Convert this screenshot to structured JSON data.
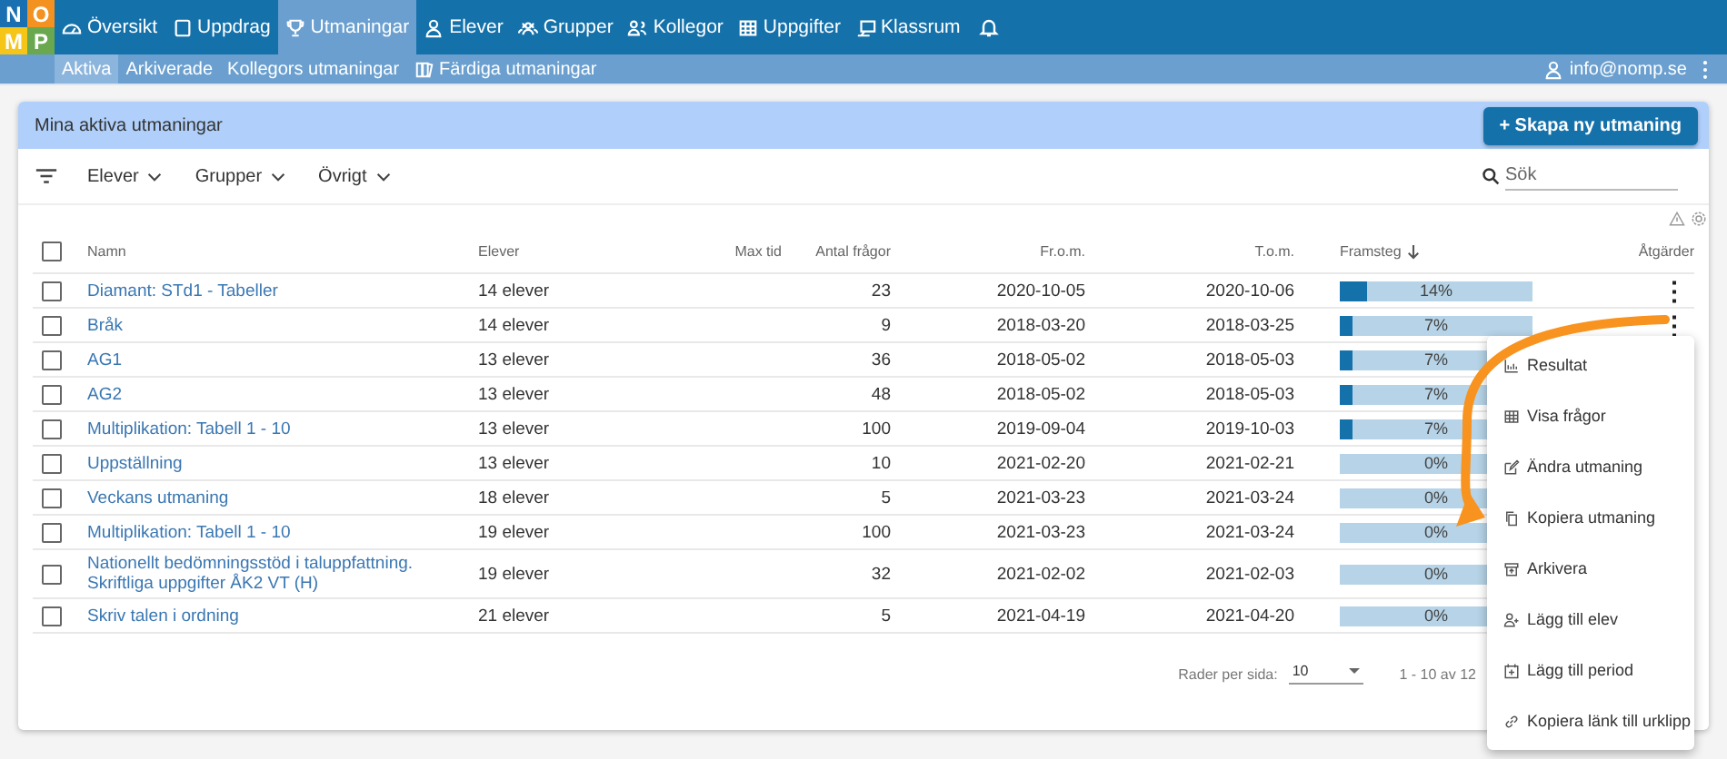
{
  "logo": {
    "letters": [
      "N",
      "O",
      "M",
      "P"
    ]
  },
  "nav": [
    {
      "label": "Översikt",
      "selected": false
    },
    {
      "label": "Uppdrag",
      "selected": false
    },
    {
      "label": "Utmaningar",
      "selected": true
    },
    {
      "label": "Elever",
      "selected": false
    },
    {
      "label": "Grupper",
      "selected": false
    },
    {
      "label": "Kollegor",
      "selected": false
    },
    {
      "label": "Uppgifter",
      "selected": false
    },
    {
      "label": "Klassrum",
      "selected": false
    }
  ],
  "subnav": [
    {
      "label": "Aktiva",
      "selected": true
    },
    {
      "label": "Arkiverade",
      "selected": false
    },
    {
      "label": "Kollegors utmaningar",
      "selected": false
    },
    {
      "label": "Färdiga utmaningar",
      "selected": false
    }
  ],
  "user": "info@nomp.se",
  "card": {
    "title": "Mina aktiva utmaningar",
    "create_button": "+ Skapa ny utmaning"
  },
  "filters": [
    "Elever",
    "Grupper",
    "Övrigt"
  ],
  "search": {
    "placeholder": "Sök"
  },
  "table": {
    "select_all_checked": false,
    "columns": [
      "Namn",
      "Elever",
      "Max tid",
      "Antal frågor",
      "Fr.o.m.",
      "T.o.m.",
      "Framsteg",
      "Åtgärder"
    ],
    "rows": [
      {
        "name": "Diamant: STd1 - Tabeller",
        "students": "14 elever",
        "questions": "23",
        "from": "2020-10-05",
        "to": "2020-10-06",
        "level": 0.14,
        "progress": "14%",
        "checked": false,
        "actions": "⋮"
      },
      {
        "name": "Bråk",
        "students": "14 elever",
        "questions": "9",
        "from": "2018-03-20",
        "to": "2018-03-25",
        "level": 0.07,
        "progress": "7%",
        "checked": false,
        "actions": "⋮"
      },
      {
        "name": "AG1",
        "students": "13 elever",
        "questions": "36",
        "from": "2018-05-02",
        "to": "2018-05-03",
        "level": 0.07,
        "progress": "7%",
        "checked": false
      },
      {
        "name": "AG2",
        "students": "13 elever",
        "questions": "48",
        "from": "2018-05-02",
        "to": "2018-05-03",
        "level": 0.07,
        "progress": "7%",
        "checked": false
      },
      {
        "name": "Multiplikation: Tabell 1 - 10",
        "students": "13 elever",
        "questions": "100",
        "from": "2019-09-04",
        "to": "2019-10-03",
        "level": 0.07,
        "progress": "7%",
        "checked": false
      },
      {
        "name": "Uppställning",
        "students": "13 elever",
        "questions": "10",
        "from": "2021-02-20",
        "to": "2021-02-21",
        "level": 0,
        "progress": "0%",
        "checked": false
      },
      {
        "name": "Veckans utmaning",
        "students": "18 elever",
        "questions": "5",
        "from": "2021-03-23",
        "to": "2021-03-24",
        "level": 0,
        "progress": "0%",
        "checked": false
      },
      {
        "name": "Multiplikation: Tabell 1 - 10",
        "students": "19 elever",
        "questions": "100",
        "from": "2021-03-23",
        "to": "2021-03-24",
        "level": 0,
        "progress": "0%",
        "checked": false
      },
      {
        "name": "Nationellt bedömningsstöd i taluppfattning. Skriftliga uppgifter ÅK2 VT (H)",
        "students": "19 elever",
        "questions": "32",
        "from": "2021-02-02",
        "to": "2021-02-03",
        "level": 0,
        "progress": "0%",
        "checked": false
      },
      {
        "name": "Skriv talen i ordning",
        "students": "21 elever",
        "questions": "5",
        "from": "2021-04-19",
        "to": "2021-04-20",
        "level": 0,
        "progress": "0%",
        "checked": false
      }
    ]
  },
  "pagination": {
    "rows_label": "Rader per sida:",
    "rows_value": "10",
    "range": "1 - 10 av 12"
  },
  "menu": [
    "Resultat",
    "Visa frågor",
    "Ändra utmaning",
    "Kopiera utmaning",
    "Arkivera",
    "Lägg till elev",
    "Lägg till period",
    "Kopiera länk till urklipp"
  ]
}
